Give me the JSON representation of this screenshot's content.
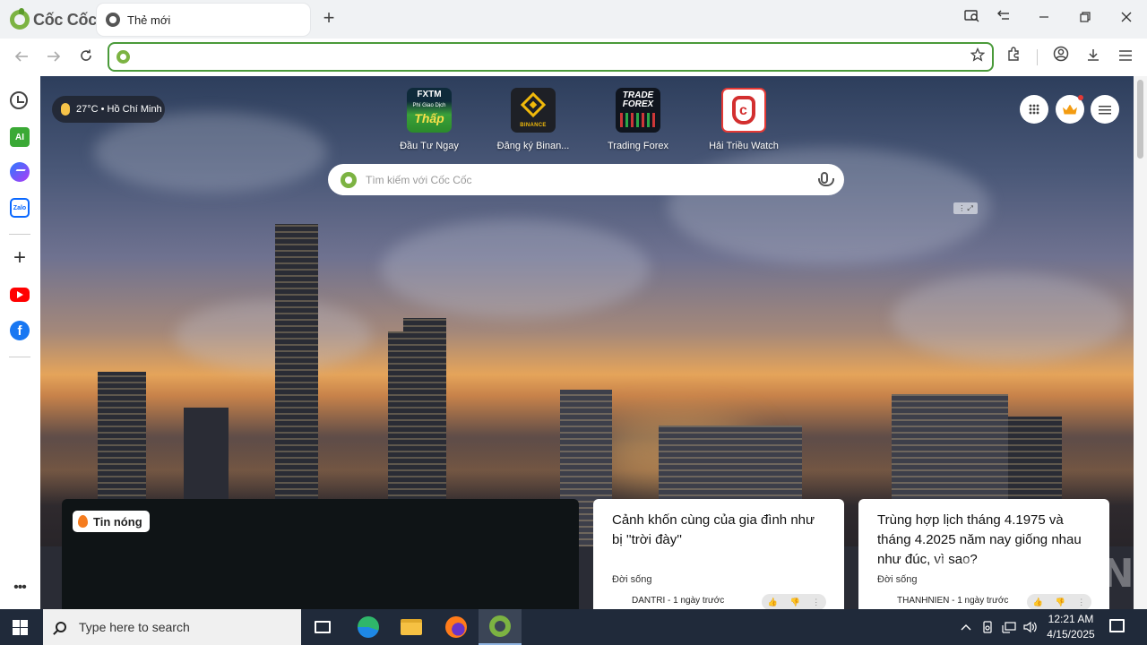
{
  "browser": {
    "brand": "Cốc Cốc",
    "tab_title": "Thẻ mới",
    "address_value": "",
    "colors": {
      "accent": "#4a9a3a",
      "brand_green": "#7cb342"
    }
  },
  "sidebar": {
    "items": [
      {
        "icon": "history-icon"
      },
      {
        "icon": "ai-icon",
        "label": "AI"
      },
      {
        "icon": "messenger-icon"
      },
      {
        "icon": "zalo-icon",
        "label": "Zalo"
      },
      {
        "icon": "add-icon",
        "label": "+"
      },
      {
        "icon": "youtube-icon"
      },
      {
        "icon": "facebook-icon",
        "label": "f"
      },
      {
        "icon": "more-icon",
        "label": "•••"
      }
    ]
  },
  "newtab": {
    "weather": "27°C • Hồ Chí Minh",
    "shortcuts": [
      {
        "label": "Đầu Tư Ngay",
        "tile_text": [
          "FXTM",
          "Phí Giao Dịch",
          "Thấp"
        ]
      },
      {
        "label": "Đăng ký Binan...",
        "tile_text": [
          "BINANCE"
        ]
      },
      {
        "label": "Trading Forex",
        "tile_text": [
          "TRADE",
          "FOREX"
        ]
      },
      {
        "label": "Hải Triều Watch",
        "tile_text": []
      }
    ],
    "search_placeholder": "Tìm kiếm với Cốc Cốc",
    "hot_news_label": "Tin nóng",
    "news": [
      {
        "title": "Cảnh khốn cùng của gia đình như bị ''trời đày''",
        "category": "Đời sống",
        "source": "DANTRI - 1 ngày trước"
      },
      {
        "title": "Trùng hợp lịch tháng 4.1975 và tháng 4.2025 năm nay giống nhau như đúc, vì sao?",
        "category": "Đời sống",
        "source": "THANHNIEN - 1 ngày trước"
      }
    ],
    "watermark": "ANY.RUN"
  },
  "taskbar": {
    "search_placeholder": "Type here to search",
    "time": "12:21 AM",
    "date": "4/15/2025"
  }
}
